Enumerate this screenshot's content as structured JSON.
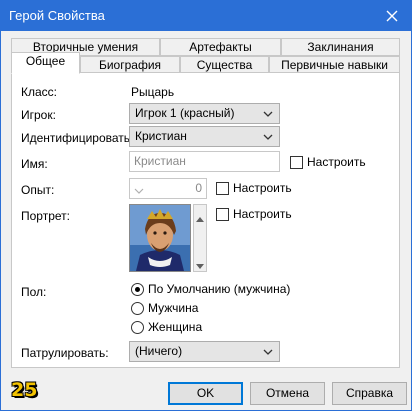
{
  "window": {
    "title": "Герой Свойства"
  },
  "tabs": {
    "row_top": [
      "Вторичные умения",
      "Артефакты",
      "Заклинания"
    ],
    "row_bottom": [
      "Общее",
      "Биография",
      "Существа",
      "Первичные навыки"
    ],
    "active": "Общее"
  },
  "form": {
    "class_label": "Класс:",
    "class_value": "Рыцарь",
    "player_label": "Игрок:",
    "player_value": "Игрок 1 (красный)",
    "identify_label": "Идентифицировать",
    "identify_value": "Кристиан",
    "name_label": "Имя:",
    "name_placeholder": "Кристиан",
    "customize_label": "Настроить",
    "experience_label": "Опыт:",
    "experience_value": "0",
    "portrait_label": "Портрет:",
    "gender_label": "Пол:",
    "gender_options": [
      "По Умолчанию (мужчина)",
      "Мужчина",
      "Женщина"
    ],
    "gender_selected": "По Умолчанию (мужчина)",
    "patrol_label": "Патрулировать:",
    "patrol_value": "(Ничего)"
  },
  "buttons": {
    "ok": "OK",
    "cancel": "Отмена",
    "help": "Справка"
  },
  "badge": {
    "text": "25"
  },
  "colors": {
    "titlebar": "#2b6fd6",
    "default_button": "#0078d7",
    "badge": "#f2c200"
  }
}
